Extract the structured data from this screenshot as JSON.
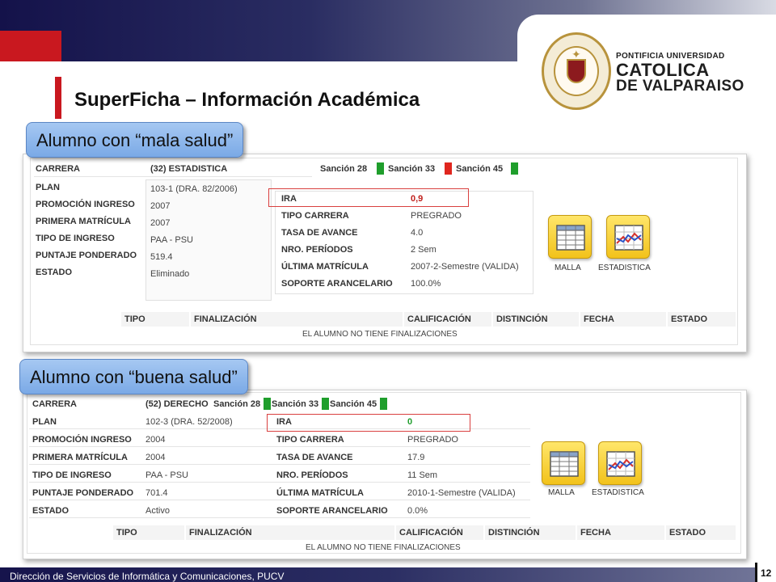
{
  "slide": {
    "title": "SuperFicha – Información Académica",
    "footer": "Dirección de Servicios de Informática y Comunicaciones, PUCV",
    "page_number": "12"
  },
  "logo": {
    "line1": "PONTIFICIA UNIVERSIDAD",
    "line2": "CATOLICA",
    "line3": "DE VALPARAISO"
  },
  "callouts": {
    "bad": "Alumno con “mala salud”",
    "good": "Alumno con “buena salud”"
  },
  "labels": {
    "carrera": "CARRERA",
    "plan": "PLAN",
    "promocion": "PROMOCIÓN INGRESO",
    "primera": "PRIMERA MATRÍCULA",
    "tipo_ingreso": "TIPO DE INGRESO",
    "puntaje": "PUNTAJE PONDERADO",
    "estado": "ESTADO",
    "ira": "IRA",
    "tipo_carrera": "TIPO CARRERA",
    "tasa": "TASA DE AVANCE",
    "periodos": "NRO. PERÍODOS",
    "ultima": "ÚLTIMA MATRÍCULA",
    "soporte": "SOPORTE ARANCELARIO",
    "sancion28": "Sanción 28",
    "sancion33": "Sanción 33",
    "sancion45": "Sanción 45",
    "malla": "MALLA",
    "estadistica": "ESTADISTICA"
  },
  "finalizaciones": {
    "columns": [
      "TIPO",
      "FINALIZACIÓN",
      "CALIFICACIÓN",
      "DISTINCIÓN",
      "FECHA",
      "ESTADO"
    ],
    "empty_note": "EL ALUMNO NO TIENE FINALIZACIONES"
  },
  "student_bad": {
    "carrera": "(32) ESTADISTICA",
    "plan": "103-1 (DRA. 82/2006)",
    "promocion": "2007",
    "primera": "2007",
    "tipo_ingreso": "PAA - PSU",
    "puntaje": "519.4",
    "estado": "Eliminado",
    "ira": "0,9",
    "tipo_carrera": "PREGRADO",
    "tasa": "4.0",
    "periodos": "2 Sem",
    "ultima": "2007-2-Semestre (VALIDA)",
    "soporte": "100.0%",
    "sanciones": {
      "s28": "#1f9e2c",
      "s33": "#e0261e",
      "s45": "#1f9e2c"
    }
  },
  "student_good": {
    "carrera": "(52) DERECHO",
    "plan": "102-3 (DRA. 52/2008)",
    "promocion": "2004",
    "primera": "2004",
    "tipo_ingreso": "PAA - PSU",
    "puntaje": "701.4",
    "estado": "Activo",
    "ira": "0",
    "tipo_carrera": "PREGRADO",
    "tasa": "17.9",
    "periodos": "11 Sem",
    "ultima": "2010-1-Semestre (VALIDA)",
    "soporte": "0.0%",
    "sanciones": {
      "s28": "#1f9e2c",
      "s33": "#1f9e2c",
      "s45": "#1f9e2c"
    }
  },
  "colors": {
    "brand_navy": "#14124a",
    "brand_red": "#c9181f",
    "ira_bad": "#c0201c",
    "ira_good": "#1f9e2c"
  },
  "icons": {
    "malla": "grid-table-icon",
    "estadistica": "line-chart-icon",
    "seal": "university-seal-icon"
  }
}
